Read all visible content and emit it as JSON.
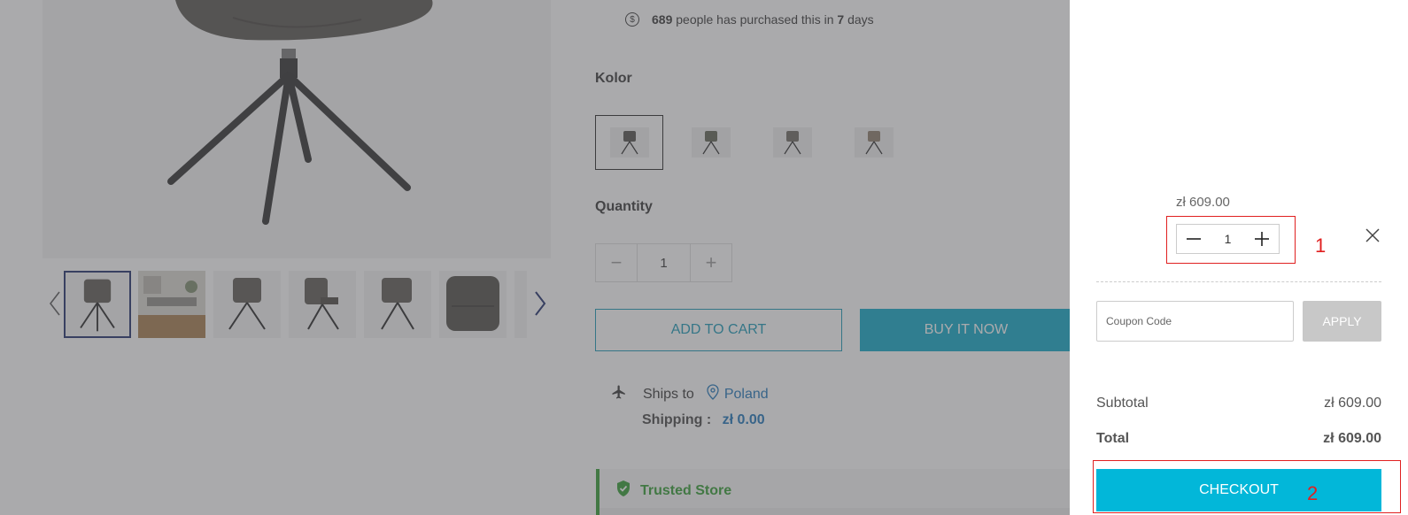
{
  "product": {
    "purchase_count": "689",
    "purchase_text": "people has purchased this in",
    "purchase_days": "7",
    "purchase_days_suffix": "days",
    "color_label": "Kolor",
    "quantity_label": "Quantity",
    "quantity_value": "1",
    "add_to_cart_label": "ADD TO CART",
    "buy_now_label": "BUY IT NOW",
    "ships_to_label": "Ships to",
    "ships_country": "Poland",
    "shipping_label": "Shipping :",
    "shipping_price": "zł 0.00",
    "trusted_label": "Trusted Store"
  },
  "cart": {
    "item_price": "zł 609.00",
    "item_quantity": "1",
    "coupon_placeholder": "Coupon Code",
    "apply_label": "APPLY",
    "subtotal_label": "Subtotal",
    "subtotal_value": "zł 609.00",
    "total_label": "Total",
    "total_value": "zł 609.00",
    "checkout_label": "CHECKOUT"
  },
  "annotations": {
    "first": "1",
    "second": "2"
  },
  "colors": {
    "accent": "#02b7d9",
    "buy_now": "#0aa6c6",
    "link": "#1a73b8",
    "trusted": "#2e9a2e",
    "annotation": "#e02020"
  }
}
